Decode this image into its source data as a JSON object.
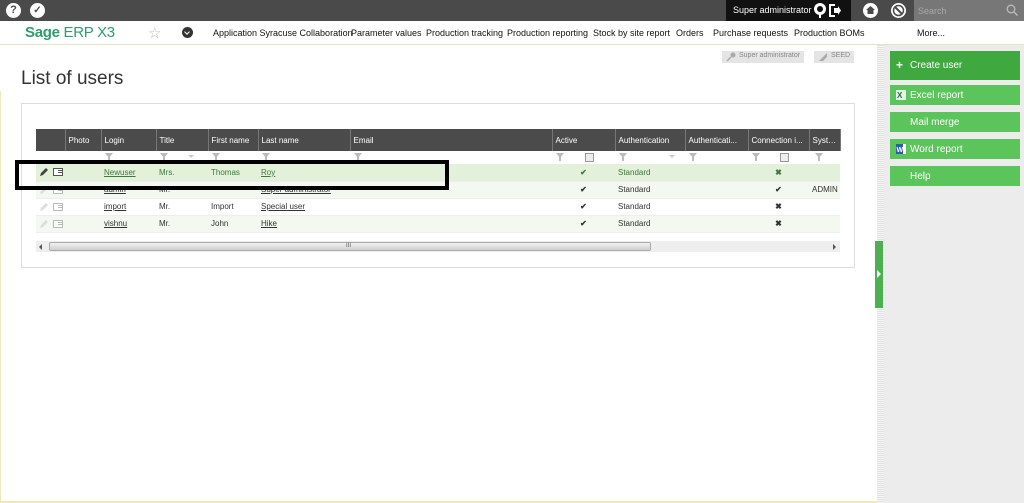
{
  "topbar": {
    "help_icon": "question-icon",
    "tools_icon": "tools-icon",
    "user_name": "Super administrator",
    "search_placeholder": "Search"
  },
  "menubar": {
    "logo_bold": "Sage",
    "logo_rest": " ERP X3",
    "items": [
      "Application Syracuse Collaboration",
      "Parameter values",
      "Production tracking",
      "Production reporting",
      "Stock by site report",
      "Orders",
      "Purchase requests",
      "Production BOMs",
      "More..."
    ]
  },
  "page": {
    "title": "List of users",
    "tags": [
      "Super administrator",
      "SEED"
    ]
  },
  "grid": {
    "columns": [
      "",
      "Photo",
      "Login",
      "Title",
      "First name",
      "Last name",
      "Email",
      "Active",
      "Authentication",
      "Authenticati...",
      "Connection i...",
      "Syste..."
    ],
    "rows": [
      {
        "login": "Newuser",
        "title": "Mrs.",
        "first_name": "Thomas",
        "last_name": "Roy",
        "email": "",
        "active": true,
        "authentication": "Standard",
        "auth2": "",
        "connection": false,
        "system": "",
        "selected": true
      },
      {
        "login": "admin",
        "title": "Mr.",
        "first_name": "",
        "last_name": "Super administrator",
        "email": "",
        "active": true,
        "authentication": "Standard",
        "auth2": "",
        "connection": true,
        "system": "ADMIN",
        "selected": false
      },
      {
        "login": "import",
        "title": "Mr.",
        "first_name": "Import",
        "last_name": "Special user",
        "email": "",
        "active": true,
        "authentication": "Standard",
        "auth2": "",
        "connection": false,
        "system": "",
        "selected": false
      },
      {
        "login": "vishnu",
        "title": "Mr.",
        "first_name": "John",
        "last_name": "Hike",
        "email": "",
        "active": true,
        "authentication": "Standard",
        "auth2": "",
        "connection": false,
        "system": "",
        "selected": false
      }
    ],
    "scroll_thumb_label": "III"
  },
  "actions": [
    {
      "label": "Create user",
      "icon": "plus-icon"
    },
    {
      "label": "Excel report",
      "icon": "excel-icon"
    },
    {
      "label": "Mail merge",
      "icon": ""
    },
    {
      "label": "Word report",
      "icon": "word-icon"
    },
    {
      "label": "Help",
      "icon": ""
    }
  ],
  "colors": {
    "accent_green": "#5bc45b",
    "primary_green": "#3fa93f",
    "topbar": "#4a4a4a",
    "logo": "#2d9d6a"
  }
}
